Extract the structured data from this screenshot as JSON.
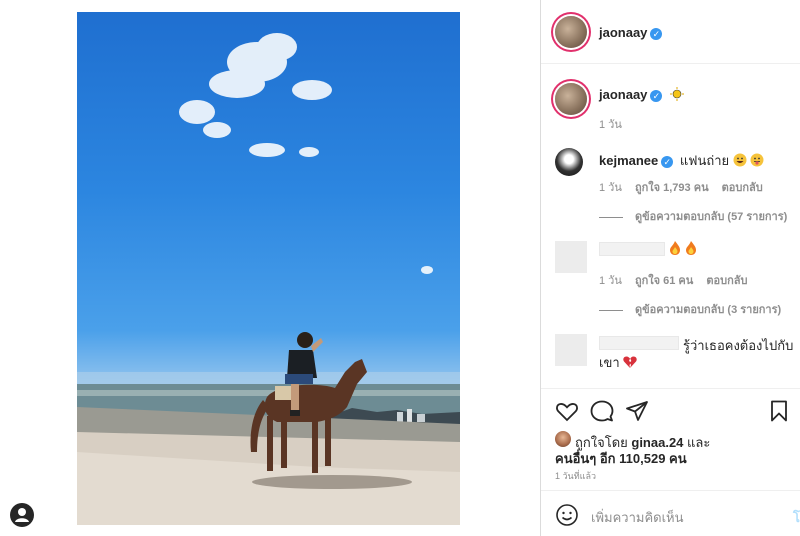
{
  "post": {
    "author": "jaonaay",
    "author_emoji": "sun-emoji",
    "age": "1 วัน"
  },
  "comments": [
    {
      "user": "kejmanee",
      "verified": true,
      "text": "แฟนถ่าย",
      "emojis": [
        "grinning-sweat-emoji",
        "tongue-out-emoji"
      ],
      "time": "1 วัน",
      "likes": "ถูกใจ 1,793 คน",
      "reply": "ตอบกลับ",
      "view_replies": "ดูข้อความตอบกลับ (57 รายการ)"
    },
    {
      "user": "",
      "text": "",
      "emojis": [
        "fire-emoji",
        "fire-emoji"
      ],
      "time": "1 วัน",
      "likes": "ถูกใจ 61 คน",
      "reply": "ตอบกลับ",
      "view_replies": "ดูข้อความตอบกลับ (3 รายการ)"
    },
    {
      "user": "",
      "text_line1": "รู้ว่าเธอคงต้องไปกับ",
      "text_line2": "เขา",
      "emojis": [
        "broken-heart-emoji"
      ]
    }
  ],
  "likes": {
    "prefix": "ถูกใจโดย",
    "first_user": "ginaa.24",
    "conj": "และ",
    "others": "คนอื่นๆ อีก 110,529 คน"
  },
  "timestamp": "1 วันที่แล้ว",
  "composer": {
    "placeholder": "เพิ่มความคิดเห็น",
    "post_label": "โ"
  },
  "colors": {
    "verified": "#3897f0",
    "story_ring": "#e1306c",
    "muted": "#8e8e8e"
  }
}
